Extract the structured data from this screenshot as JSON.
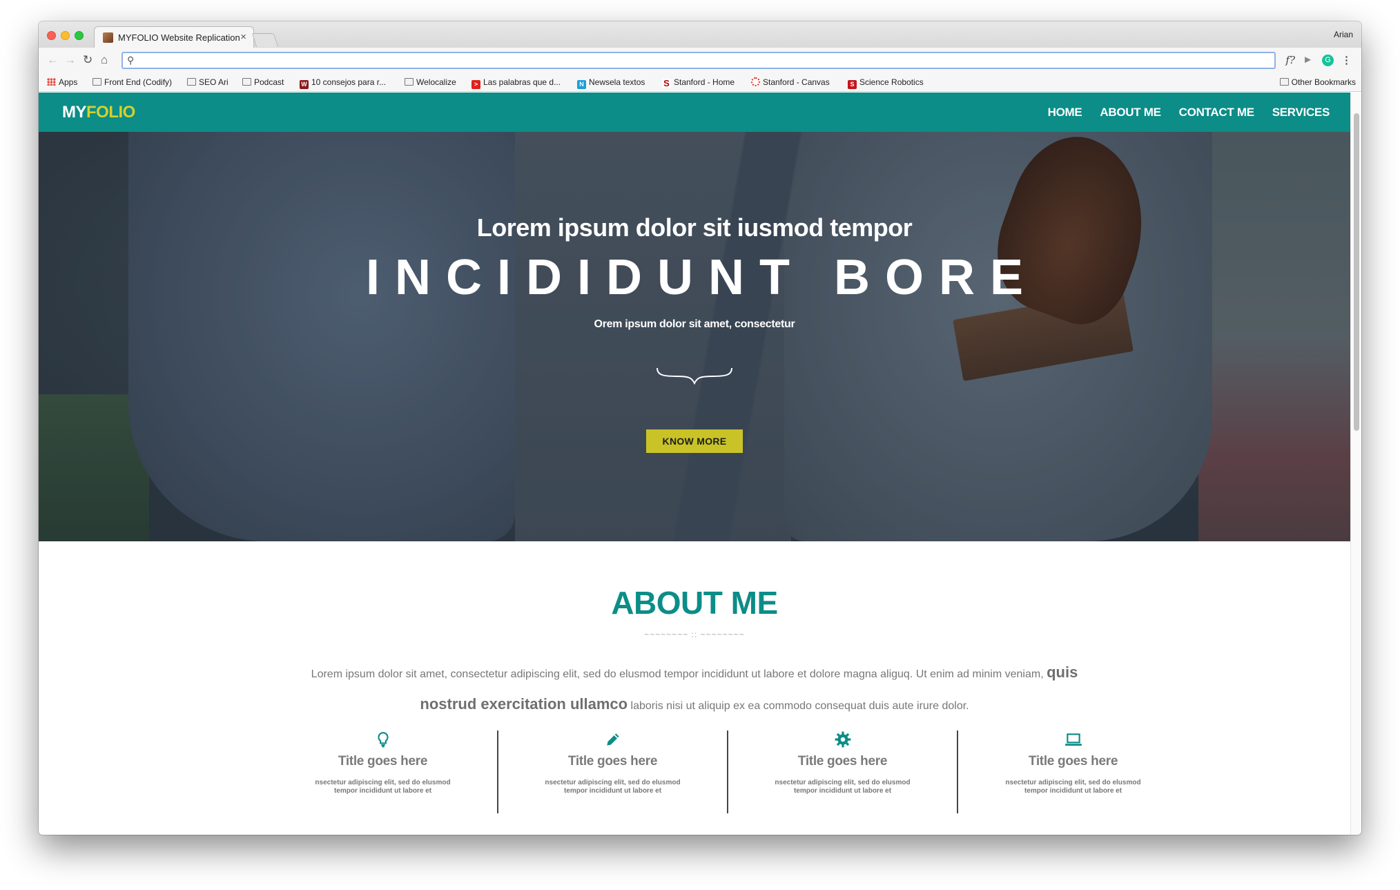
{
  "browser": {
    "tab_title": "MYFOLIO Website Replication",
    "tab_close": "×",
    "profile_name": "Arian",
    "address_value": "",
    "bookmarks": [
      {
        "label": "Apps",
        "icon": "apps-icon"
      },
      {
        "label": "Front End (Codify)",
        "icon": "folder-icon"
      },
      {
        "label": "SEO Ari",
        "icon": "folder-icon"
      },
      {
        "label": "Podcast",
        "icon": "folder-icon"
      },
      {
        "label": "10 consejos para r...",
        "icon": "w-favicon"
      },
      {
        "label": "Welocalize",
        "icon": "folder-icon"
      },
      {
        "label": "Las palabras que d...",
        "icon": "red-favicon"
      },
      {
        "label": "Newsela textos",
        "icon": "n-favicon"
      },
      {
        "label": "Stanford - Home",
        "icon": "stanford-favicon"
      },
      {
        "label": "Stanford - Canvas",
        "icon": "canvas-favicon"
      },
      {
        "label": "Science Robotics",
        "icon": "s-favicon"
      }
    ],
    "other_bookmarks": "Other Bookmarks",
    "ext_label": "f?"
  },
  "site": {
    "logo_part1": "MY",
    "logo_part2": "FOLIO",
    "menu": [
      "HOME",
      "ABOUT ME",
      "CONTACT ME",
      "SERVICES"
    ],
    "colors": {
      "primary": "#0c8d87",
      "accent": "#c9c327"
    }
  },
  "hero": {
    "subtitle": "Lorem ipsum dolor sit iusmod tempor",
    "title": "INCIDIDUNT BORE",
    "small": "Orem ipsum dolor sit amet, consectetur",
    "button": "KNOW MORE"
  },
  "about": {
    "title": "ABOUT ME",
    "ornament": "~~~~~~~~ :: ~~~~~~~~",
    "text_a": "Lorem ipsum dolor sit amet, consectetur adipiscing elit, sed do elusmod tempor incididunt ut labore et dolore magna aliguq. Ut enim ad minim veniam, ",
    "text_big1": "quis nostrud exercitation ullamco",
    "text_b": " laboris nisi ut aliquip ex ea commodo consequat duis aute irure dolor.",
    "features": [
      {
        "icon": "lightbulb-icon",
        "title": "Title goes here",
        "desc": "nsectetur adipiscing elit, sed do elusmod tempor incididunt ut labore et"
      },
      {
        "icon": "pencil-icon",
        "title": "Title goes here",
        "desc": "nsectetur adipiscing elit, sed do elusmod tempor incididunt ut labore et"
      },
      {
        "icon": "gear-icon",
        "title": "Title goes here",
        "desc": "nsectetur adipiscing elit, sed do elusmod tempor incididunt ut labore et"
      },
      {
        "icon": "laptop-icon",
        "title": "Title goes here",
        "desc": "nsectetur adipiscing elit, sed do elusmod tempor incididunt ut labore et"
      }
    ]
  }
}
